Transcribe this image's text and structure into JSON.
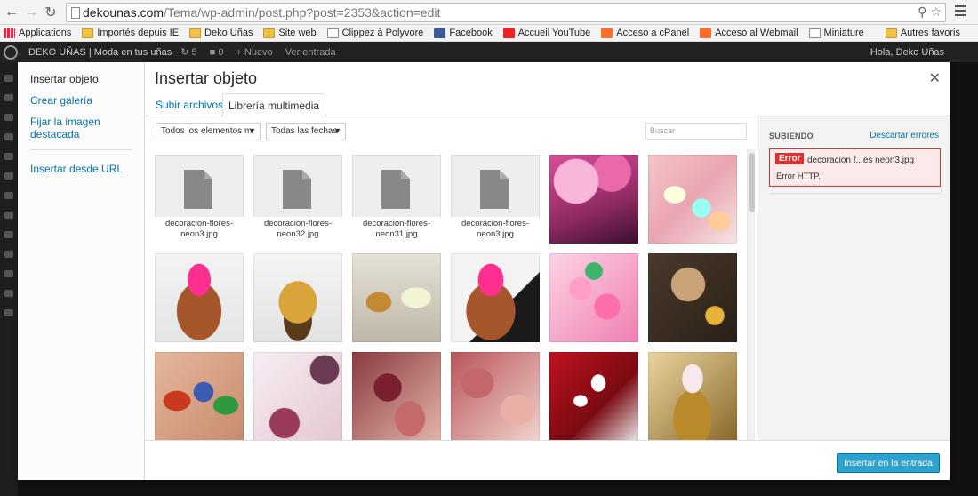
{
  "browser": {
    "url_host": "dekounas.com",
    "url_path": "/Tema/wp-admin/post.php?post=2353&action=edit",
    "bookmarks": [
      {
        "label": "Applications",
        "icon": "apps-icon"
      },
      {
        "label": "Importés depuis IE",
        "icon": "folder-icon"
      },
      {
        "label": "Deko Uñas",
        "icon": "folder-icon"
      },
      {
        "label": "Site web",
        "icon": "folder-icon"
      },
      {
        "label": "Clippez à Polyvore",
        "icon": "page-icon"
      },
      {
        "label": "Facebook",
        "icon": "facebook-icon"
      },
      {
        "label": "Accueil YouTube",
        "icon": "youtube-icon"
      },
      {
        "label": "Acceso a cPanel",
        "icon": "cpanel-icon"
      },
      {
        "label": "Acceso al Webmail",
        "icon": "cpanel-icon"
      },
      {
        "label": "Miniature",
        "icon": "page-icon"
      }
    ],
    "other_bookmarks": "Autres favoris"
  },
  "adminbar": {
    "site": "DEKO UÑAS | Moda en tus uñas",
    "updates": "5",
    "comments": "0",
    "new": "Nuevo",
    "view": "Ver entrada",
    "hello": "Hola, Deko Uñas"
  },
  "modal": {
    "title": "Insertar objeto",
    "menu": [
      {
        "label": "Insertar objeto",
        "active": true
      },
      {
        "label": "Crear galería",
        "active": false
      },
      {
        "label": "Fijar la imagen destacada",
        "active": false
      }
    ],
    "menu_after_sep": "Insertar desde URL",
    "tabs": {
      "upload": "Subir archivos",
      "library": "Librería multimedia"
    },
    "filters": {
      "types": "Todos los elementos m",
      "dates": "Todas las fechas"
    },
    "search_placeholder": "Buscar",
    "files": [
      {
        "name": "decoracion-flores-neon3.jpg"
      },
      {
        "name": "decoracion-flores-neon32.jpg"
      },
      {
        "name": "decoracion-flores-neon31.jpg"
      },
      {
        "name": "decoracion-flores-neon3.jpg"
      }
    ],
    "sidebar": {
      "heading": "SUBIENDO",
      "dismiss": "Descartar errores",
      "error_tag": "Error",
      "error_file": "decoracion f...es neon3.jpg",
      "error_msg": "Error HTTP."
    },
    "insert_button": "Insertar en la entrada"
  }
}
